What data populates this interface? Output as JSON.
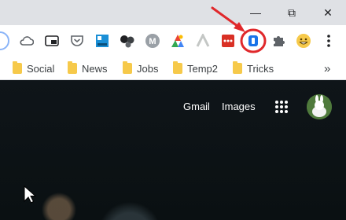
{
  "window_controls": {
    "minimize": "—",
    "restore": "⧉",
    "close": "✕"
  },
  "toolbar": {
    "extensions": [
      "cloud-icon",
      "picture-in-picture-icon",
      "pocket-icon",
      "blue-square-extension-icon",
      "balls-extension-icon",
      "m-extension-icon",
      "photos-extension-icon",
      "vector-extension-icon",
      "red-dots-extension-icon",
      "highlighted-extension-icon",
      "puzzle-icon",
      "emoji-icon",
      "menu-dots-icon"
    ]
  },
  "bookmarks": [
    {
      "label": "Social"
    },
    {
      "label": "News"
    },
    {
      "label": "Jobs"
    },
    {
      "label": "Temp2"
    },
    {
      "label": "Tricks"
    }
  ],
  "bookmarks_more": "»",
  "google": {
    "gmail": "Gmail",
    "images": "Images"
  },
  "colors": {
    "annotation_red": "#e0282b",
    "titlebar": "#dfe1e5"
  }
}
